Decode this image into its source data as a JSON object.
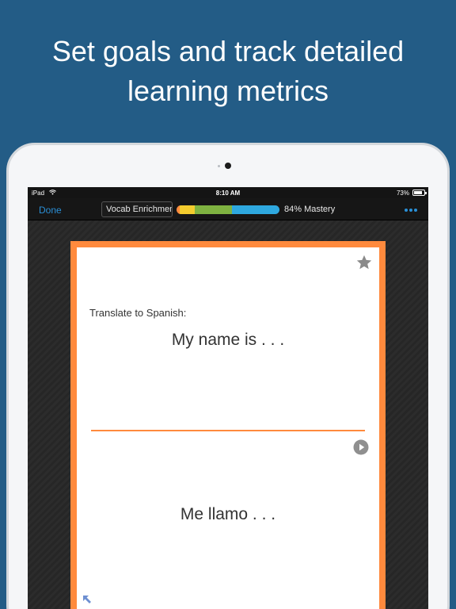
{
  "headline": {
    "line1": "Set goals and track detailed",
    "line2": "learning metrics"
  },
  "statusbar": {
    "carrier": "iPad",
    "time": "8:10 AM",
    "battery": "73%"
  },
  "navbar": {
    "done_label": "Done",
    "deck_title": "Vocab Enrichment",
    "mastery_label": "84% Mastery",
    "mastery_segments": [
      {
        "color": "#ff8a3d",
        "fraction": 0.03
      },
      {
        "color": "#f3cc2e",
        "fraction": 0.15
      },
      {
        "color": "#7fb241",
        "fraction": 0.36
      },
      {
        "color": "#2ea8df",
        "fraction": 0.46
      }
    ],
    "more_icon": "ellipsis-icon"
  },
  "card": {
    "prompt": "Translate to Spanish:",
    "front": "My name is . . .",
    "back": "Me llamo . . .",
    "accent_color": "#ff8a3d",
    "star_icon": "star-icon",
    "play_icon": "play-audio-icon",
    "expand_icon": "expand-arrow-icon"
  },
  "colors": {
    "background": "#235c86",
    "link": "#2a8fd6"
  }
}
